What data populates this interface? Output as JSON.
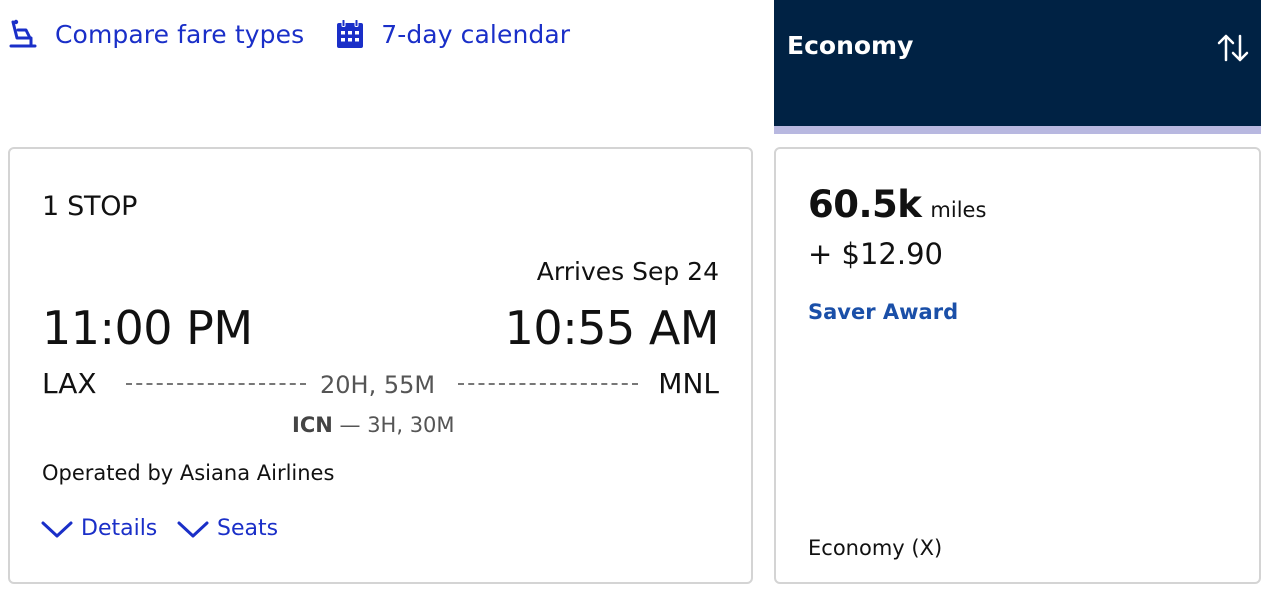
{
  "toolbar": {
    "compare_label": "Compare fare types",
    "calendar_label": "7-day calendar"
  },
  "fare_column": {
    "title": "Economy"
  },
  "flight": {
    "stops": "1 STOP",
    "arrives": "Arrives Sep 24",
    "departure_time": "11:00 PM",
    "arrival_time": "10:55 AM",
    "origin": "LAX",
    "destination": "MNL",
    "duration": "20H, 55M",
    "layover_airport": "ICN",
    "layover_separator": "—",
    "layover_duration": "3H, 30M",
    "operated_by": "Operated by Asiana Airlines",
    "details_label": "Details",
    "seats_label": "Seats"
  },
  "price": {
    "miles": "60.5k",
    "miles_unit": "miles",
    "taxes": "+ $12.90",
    "award_type": "Saver Award",
    "cabin": "Economy (X)"
  },
  "colors": {
    "link": "#1a2fc8",
    "header_bg": "#002244",
    "header_bar": "#b8b8e0",
    "award": "#1a4fa8"
  }
}
